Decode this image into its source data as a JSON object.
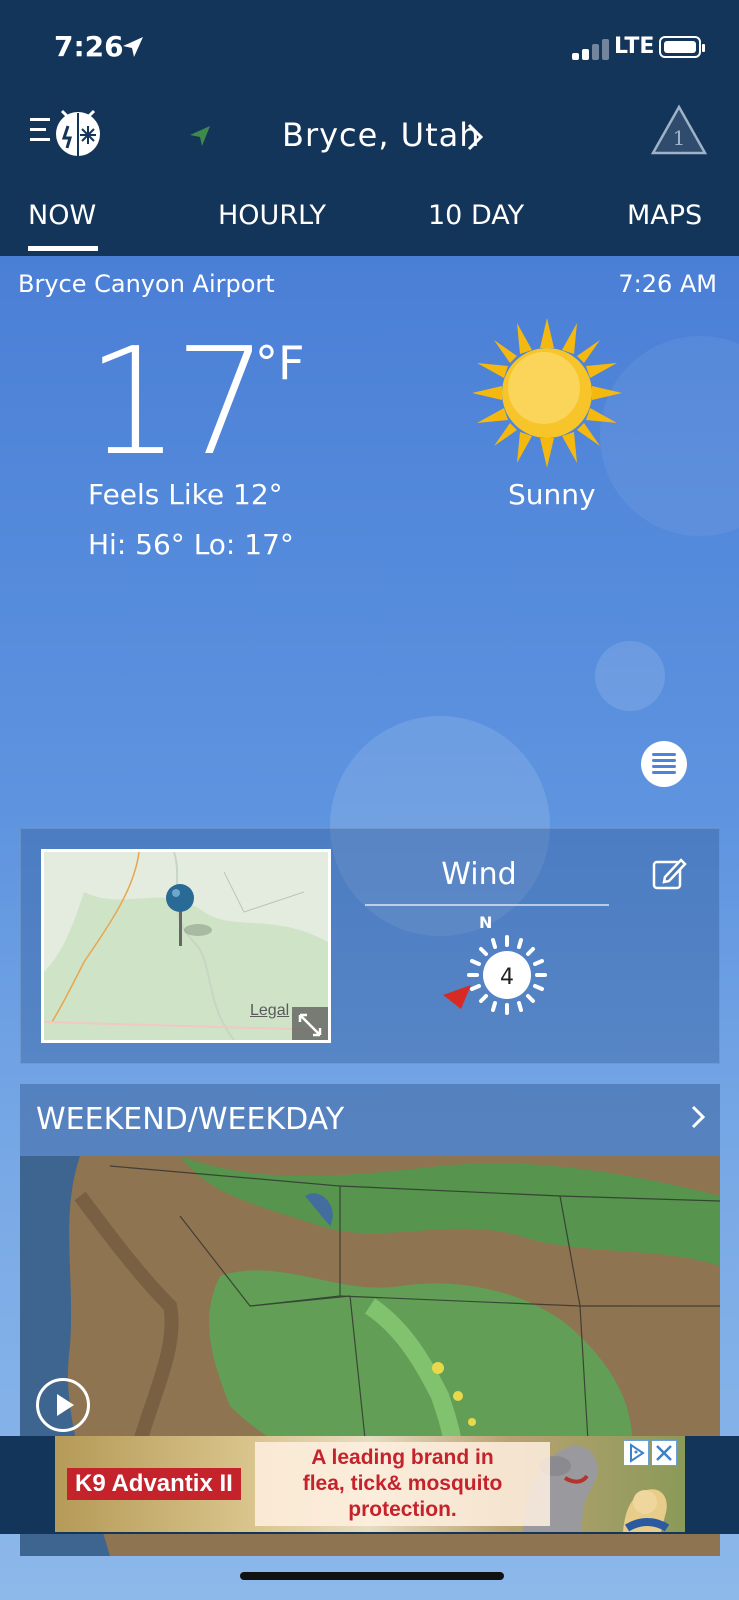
{
  "status_bar": {
    "time": "7:26",
    "network": "LTE",
    "icons": [
      "location-arrow-icon",
      "signal-bars-icon",
      "battery-icon"
    ]
  },
  "header": {
    "location": "Bryce, Utah",
    "alert_count": "1",
    "icons": [
      "menu-icon",
      "weatherbug-logo",
      "location-nav-icon",
      "chevron-right-icon",
      "alert-triangle-icon"
    ]
  },
  "tabs": [
    {
      "label": "NOW",
      "active": true
    },
    {
      "label": "HOURLY",
      "active": false
    },
    {
      "label": "10 DAY",
      "active": false
    },
    {
      "label": "MAPS",
      "active": false
    }
  ],
  "current": {
    "station": "Bryce Canyon Airport",
    "time": "7:26 AM",
    "temperature": "17",
    "unit": "°F",
    "feels_like": "Feels Like 12°",
    "hi_lo": "Hi: 56° Lo: 17°",
    "condition": "Sunny",
    "condition_icon": "sun-icon"
  },
  "wind_card": {
    "title": "Wind",
    "direction_label": "N",
    "speed": "4",
    "map_legal": "Legal",
    "icons": [
      "map-pin-icon",
      "expand-icon",
      "edit-icon",
      "wind-dial-icon"
    ]
  },
  "feature": {
    "title": "WEEKEND/WEEKDAY",
    "icons": [
      "chevron-right-icon",
      "play-icon"
    ]
  },
  "ad": {
    "brand": "K9 Advantix II",
    "line1": "A leading brand in",
    "line2": "flea, tick& mosquito",
    "line3": "protection.",
    "icons": [
      "ad-choices-icon",
      "close-icon"
    ]
  },
  "colors": {
    "header_bg": "#14355a",
    "sky_top": "#4a7fd6",
    "ad_red": "#c4232c",
    "sun": "#f5b80f"
  }
}
